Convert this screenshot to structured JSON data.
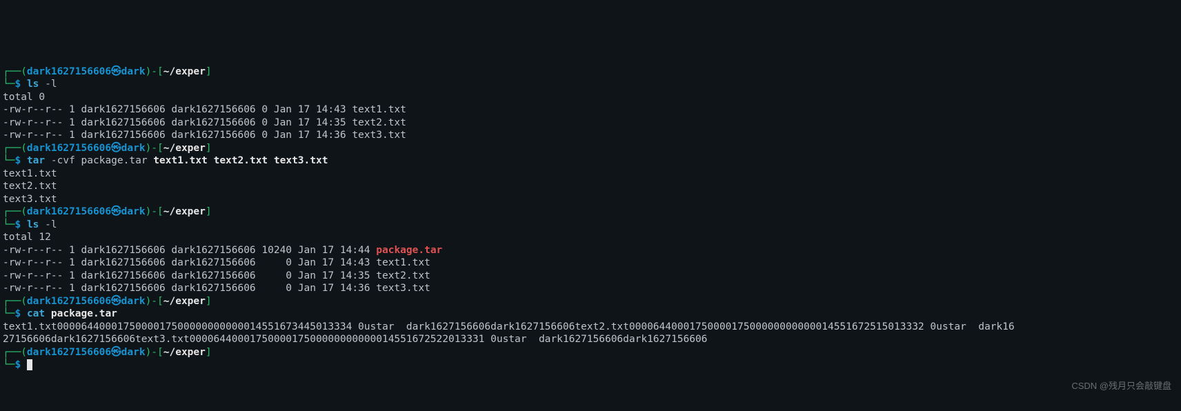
{
  "prompt": {
    "user": "dark1627156606",
    "icon": "㉿",
    "host": "dark",
    "path": "~/exper",
    "open1": "┌──(",
    "close1": ")-[",
    "close2": "]",
    "line2": "└─",
    "sigil": "$"
  },
  "blocks": [
    {
      "cmd": {
        "exe": "ls",
        "args": "-l"
      },
      "out": [
        [
          {
            "cls": "normal",
            "t": "total 0"
          }
        ],
        [
          {
            "cls": "normal",
            "t": "-rw-r--r-- 1 dark1627156606 dark1627156606 0 Jan 17 14:43 text1.txt"
          }
        ],
        [
          {
            "cls": "normal",
            "t": "-rw-r--r-- 1 dark1627156606 dark1627156606 0 Jan 17 14:35 text2.txt"
          }
        ],
        [
          {
            "cls": "normal",
            "t": "-rw-r--r-- 1 dark1627156606 dark1627156606 0 Jan 17 14:36 text3.txt"
          }
        ]
      ]
    },
    {
      "cmd": {
        "exe": "tar",
        "args": "-cvf",
        "extra": "package.tar",
        "extraBold": "text1.txt text2.txt text3.txt"
      },
      "out": [
        [
          {
            "cls": "normal",
            "t": "text1.txt"
          }
        ],
        [
          {
            "cls": "normal",
            "t": "text2.txt"
          }
        ],
        [
          {
            "cls": "normal",
            "t": "text3.txt"
          }
        ]
      ]
    },
    {
      "cmd": {
        "exe": "ls",
        "args": "-l"
      },
      "out": [
        [
          {
            "cls": "normal",
            "t": "total 12"
          }
        ],
        [
          {
            "cls": "normal",
            "t": "-rw-r--r-- 1 dark1627156606 dark1627156606 10240 Jan 17 14:44 "
          },
          {
            "cls": "red",
            "t": "package.tar"
          }
        ],
        [
          {
            "cls": "normal",
            "t": "-rw-r--r-- 1 dark1627156606 dark1627156606     0 Jan 17 14:43 text1.txt"
          }
        ],
        [
          {
            "cls": "normal",
            "t": "-rw-r--r-- 1 dark1627156606 dark1627156606     0 Jan 17 14:35 text2.txt"
          }
        ],
        [
          {
            "cls": "normal",
            "t": "-rw-r--r-- 1 dark1627156606 dark1627156606     0 Jan 17 14:36 text3.txt"
          }
        ]
      ]
    },
    {
      "cmd": {
        "exe": "cat",
        "extraBold": "package.tar"
      },
      "out": [
        [
          {
            "cls": "normal",
            "t": "text1.txt0000644000175000017500000000000014551673445013334 0ustar  dark1627156606dark1627156606text2.txt0000644000175000017500000000000014551672515013332 0ustar  dark16"
          }
        ],
        [
          {
            "cls": "normal",
            "t": "27156606dark1627156606text3.txt0000644000175000017500000000000014551672522013331 0ustar  dark1627156606dark1627156606"
          }
        ]
      ]
    },
    {
      "cmd": {
        "cursor": true
      },
      "out": []
    }
  ],
  "watermark": "CSDN @残月只会敲键盘"
}
